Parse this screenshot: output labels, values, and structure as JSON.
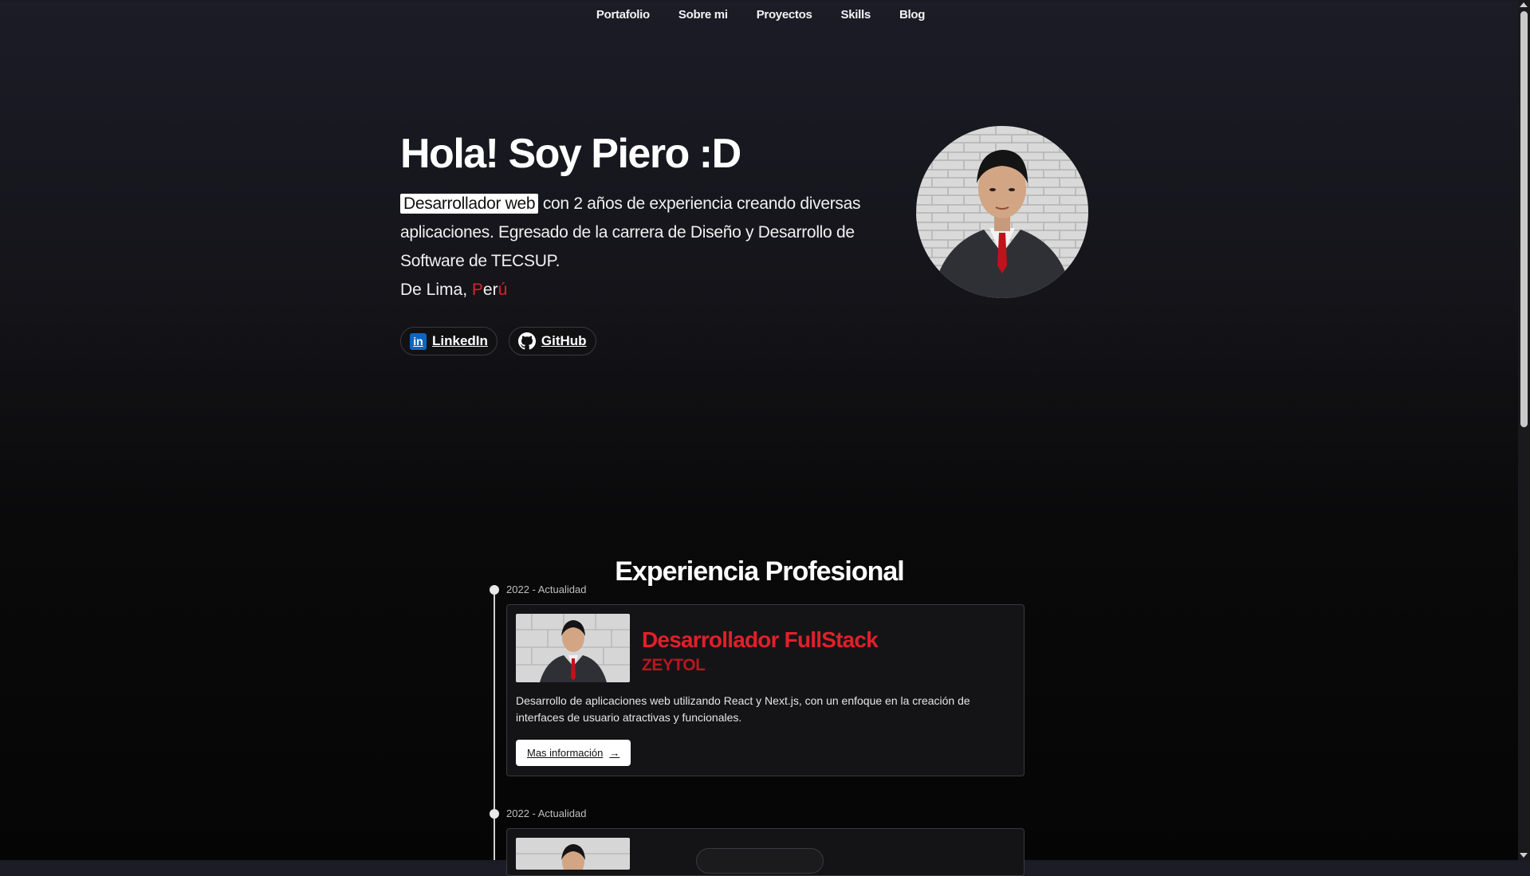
{
  "nav": {
    "items": [
      "Portafolio",
      "Sobre mi",
      "Proyectos",
      "Skills",
      "Blog"
    ]
  },
  "hero": {
    "title": "Hola! Soy Piero :D",
    "highlight": "Desarrollador web",
    "intro_rest": " con 2 años de experiencia creando diversas aplicaciones. Egresado de la carrera de Diseño y Desarrollo de Software de TECSUP.",
    "location_prefix": "De Lima, ",
    "location_p": "P",
    "location_er": "er",
    "location_u": "ú",
    "socials": [
      {
        "label": "LinkedIn",
        "icon": "linkedin-icon"
      },
      {
        "label": "GitHub",
        "icon": "github-icon"
      }
    ]
  },
  "experience": {
    "title": "Experiencia Profesional",
    "items": [
      {
        "date": "2022 - Actualidad",
        "role": "Desarrollador FullStack",
        "company": "ZEYTOL",
        "description": "Desarrollo de aplicaciones web utilizando React y Next.js, con un enfoque en la creación de interfaces de usuario atractivas y funcionales.",
        "button": "Mas información"
      },
      {
        "date": "2022 - Actualidad"
      }
    ]
  },
  "colors": {
    "accent_red": "#e0202a",
    "background": "#0a0a0b",
    "linkedin_blue": "#0a66c2"
  }
}
